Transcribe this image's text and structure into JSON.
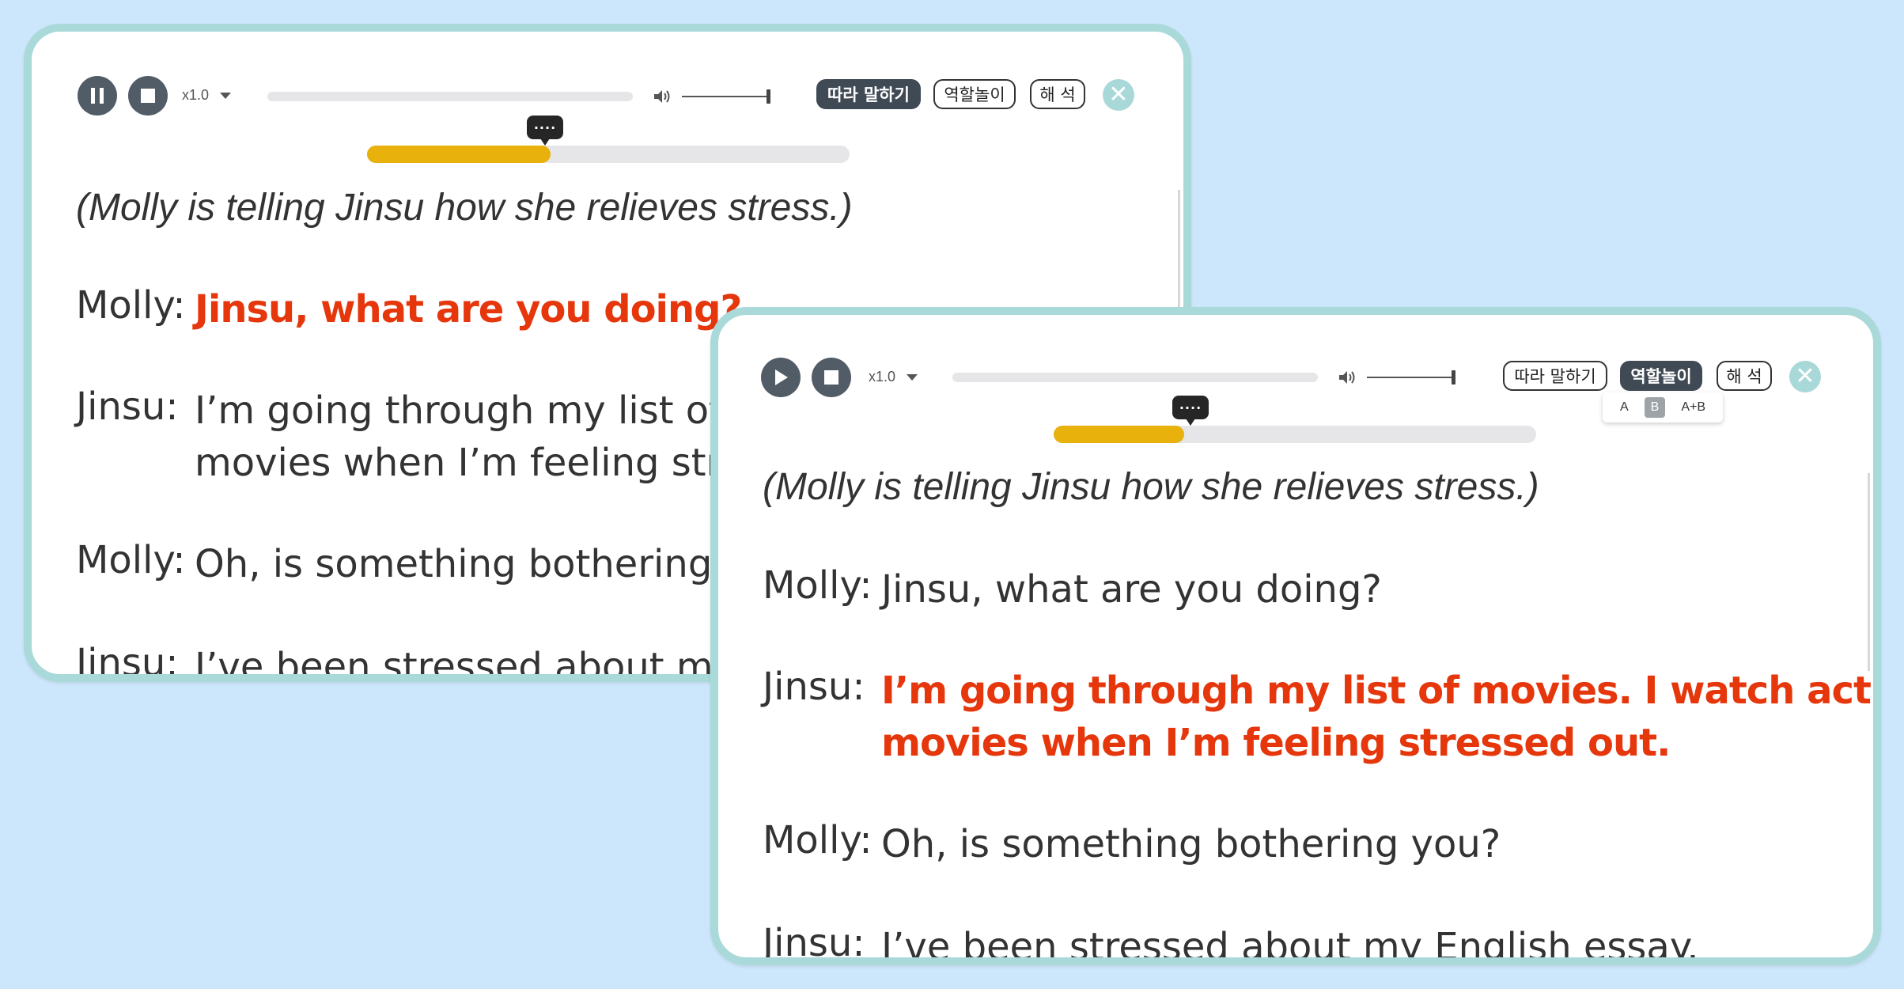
{
  "panel_a": {
    "speed": "x1.0",
    "buttons": {
      "repeat": "따라 말하기",
      "roleplay": "역할놀이",
      "translate": "해 석"
    },
    "active_button": "repeat",
    "bubble": "····",
    "progress": 0.38,
    "scene": "(Molly is telling Jinsu how she relieves stress.)",
    "lines": [
      {
        "speaker": "Molly:",
        "text": "Jinsu, what are you doing?",
        "highlight": true
      },
      {
        "speaker": "Jinsu:",
        "text": "I’m going through my list of mo",
        "text2": "movies when I’m feeling stresse",
        "highlight": false
      },
      {
        "speaker": "Molly:",
        "text": "Oh, is something bothering you",
        "highlight": false
      },
      {
        "speaker": "Jinsu:",
        "text": "I’ve been stressed about my En",
        "highlight": false
      }
    ]
  },
  "panel_b": {
    "speed": "x1.0",
    "buttons": {
      "repeat": "따라 말하기",
      "roleplay": "역할놀이",
      "translate": "해 석"
    },
    "active_button": "roleplay",
    "role_options": [
      "A",
      "B",
      "A+B"
    ],
    "role_selected": "B",
    "bubble": "····",
    "progress": 0.27,
    "scene": "(Molly is telling Jinsu how she relieves stress.)",
    "lines": [
      {
        "speaker": "Molly:",
        "text": "Jinsu, what are you doing?",
        "highlight": false
      },
      {
        "speaker": "Jinsu:",
        "text": "I’m going through my list of movies. I watch action",
        "text2": "movies when I’m feeling stressed out.",
        "highlight": true
      },
      {
        "speaker": "Molly:",
        "text": "Oh, is something bothering you?",
        "highlight": false
      },
      {
        "speaker": "Jinsu:",
        "text": "I’ve been stressed about my English essay.",
        "highlight": false
      }
    ]
  },
  "colors": {
    "background": "#cce6fb",
    "frame": "#aad9d9",
    "highlight": "#e5360c",
    "progress": "#e8b10c",
    "button_active": "#3f4a55"
  }
}
